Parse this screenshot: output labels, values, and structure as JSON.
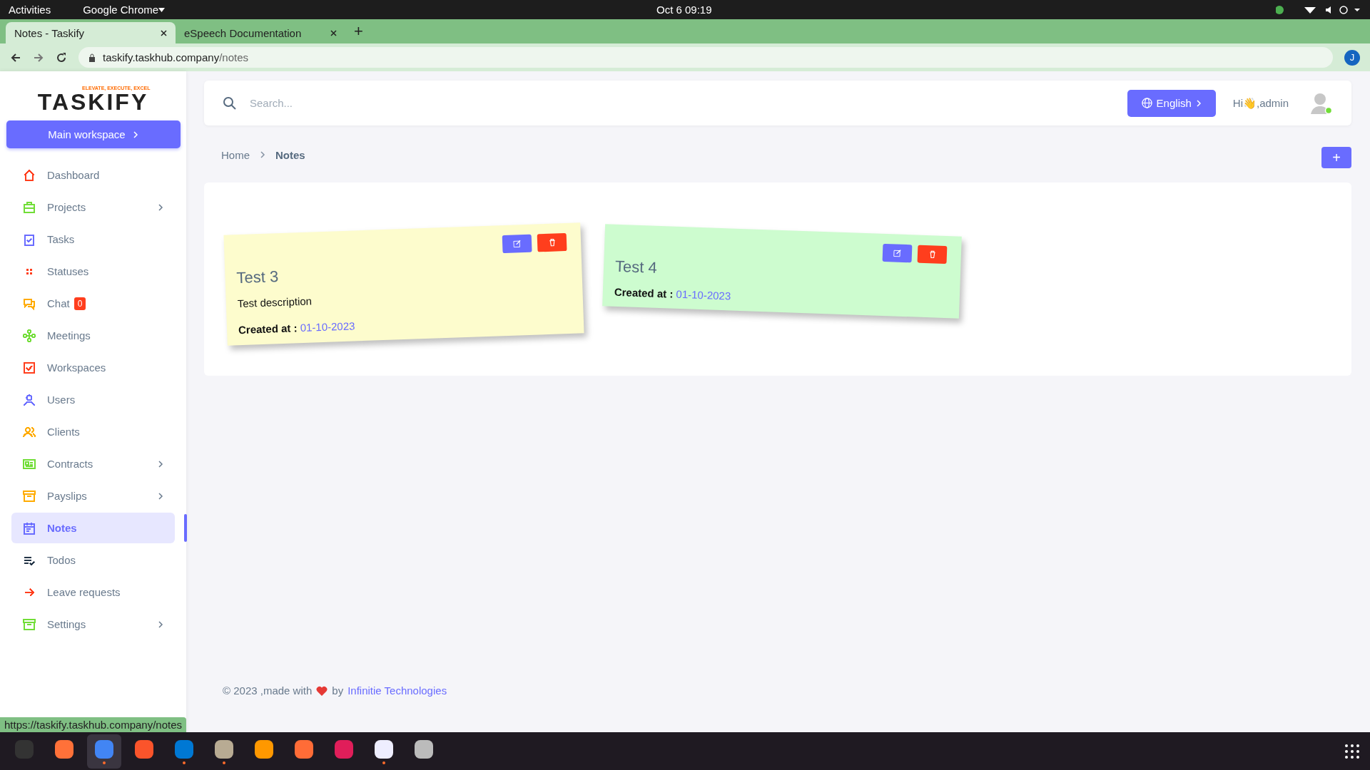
{
  "system_bar": {
    "activities": "Activities",
    "app": "Google Chrome",
    "clock": "Oct 6  09:19"
  },
  "browser": {
    "tabs": [
      {
        "title": "Notes - Taskify",
        "selected": true
      },
      {
        "title": "eSpeech Documentation",
        "selected": false
      }
    ],
    "new_tab": "+",
    "url_host": "taskify.taskhub.company",
    "url_path": "/notes",
    "profile": "J"
  },
  "sidebar": {
    "logo": "TASKIFY",
    "tagline": "ELEVATE, EXECUTE, EXCEL",
    "workspace_button": "Main workspace",
    "items": [
      {
        "label": "Dashboard",
        "kind": "home",
        "color": "#ff3e1d",
        "selected": false,
        "submenu": false
      },
      {
        "label": "Projects",
        "kind": "briefcase",
        "color": "#71dd37",
        "selected": false,
        "submenu": true
      },
      {
        "label": "Tasks",
        "kind": "clipboard",
        "color": "#696cff",
        "selected": false,
        "submenu": false
      },
      {
        "label": "Statuses",
        "kind": "grid",
        "color": "#ff3e1d",
        "selected": false,
        "submenu": false
      },
      {
        "label": "Chat",
        "kind": "chat",
        "color": "#ffab00",
        "selected": false,
        "submenu": false,
        "badge": "0"
      },
      {
        "label": "Meetings",
        "kind": "nodes",
        "color": "#71dd37",
        "selected": false,
        "submenu": false
      },
      {
        "label": "Workspaces",
        "kind": "checkbox",
        "color": "#ff3e1d",
        "selected": false,
        "submenu": false
      },
      {
        "label": "Users",
        "kind": "user",
        "color": "#696cff",
        "selected": false,
        "submenu": false
      },
      {
        "label": "Clients",
        "kind": "users",
        "color": "#ffab00",
        "selected": false,
        "submenu": false
      },
      {
        "label": "Contracts",
        "kind": "card",
        "color": "#71dd37",
        "selected": false,
        "submenu": true
      },
      {
        "label": "Payslips",
        "kind": "archive",
        "color": "#ffab00",
        "selected": false,
        "submenu": true
      },
      {
        "label": "Notes",
        "kind": "calendar",
        "color": "#696cff",
        "selected": true,
        "submenu": false
      },
      {
        "label": "Todos",
        "kind": "list",
        "color": "#233446",
        "selected": false,
        "submenu": false
      },
      {
        "label": "Leave requests",
        "kind": "arrow",
        "color": "#ff3e1d",
        "selected": false,
        "submenu": false
      },
      {
        "label": "Settings",
        "kind": "archive",
        "color": "#71dd37",
        "selected": false,
        "submenu": true
      }
    ]
  },
  "header": {
    "search_placeholder": "Search...",
    "language": "English",
    "greeting": "Hi👋,admin"
  },
  "breadcrumb": [
    {
      "label": "Home",
      "selected": false
    },
    {
      "label": "Notes",
      "selected": true
    }
  ],
  "add_button": "+",
  "notes": [
    {
      "title": "Test 3",
      "description": "Test description",
      "created_label": "Created at :",
      "created_date": "01-10-2023",
      "color": "#fdfccd"
    },
    {
      "title": "Test 4",
      "created_label": "Created at :",
      "created_date": "01-10-2023",
      "color": "#cdfccf"
    }
  ],
  "footer": {
    "text": "© 2023 ,made with",
    "by": "by",
    "link": "Infinitie Technologies"
  },
  "status_url": "https://taskify.taskhub.company/notes",
  "taskbar": [
    {
      "kind": "terminal",
      "running": false,
      "selected": false
    },
    {
      "kind": "firefox",
      "running": false,
      "selected": false
    },
    {
      "kind": "chrome",
      "running": true,
      "selected": true
    },
    {
      "kind": "brave",
      "running": false,
      "selected": false
    },
    {
      "kind": "vscode",
      "running": true,
      "selected": false
    },
    {
      "kind": "files",
      "running": true,
      "selected": false
    },
    {
      "kind": "sublime",
      "running": false,
      "selected": false
    },
    {
      "kind": "postman",
      "running": false,
      "selected": false
    },
    {
      "kind": "slack",
      "running": false,
      "selected": false
    },
    {
      "kind": "editor",
      "running": true,
      "selected": false
    },
    {
      "kind": "usb",
      "running": false,
      "selected": false
    }
  ]
}
